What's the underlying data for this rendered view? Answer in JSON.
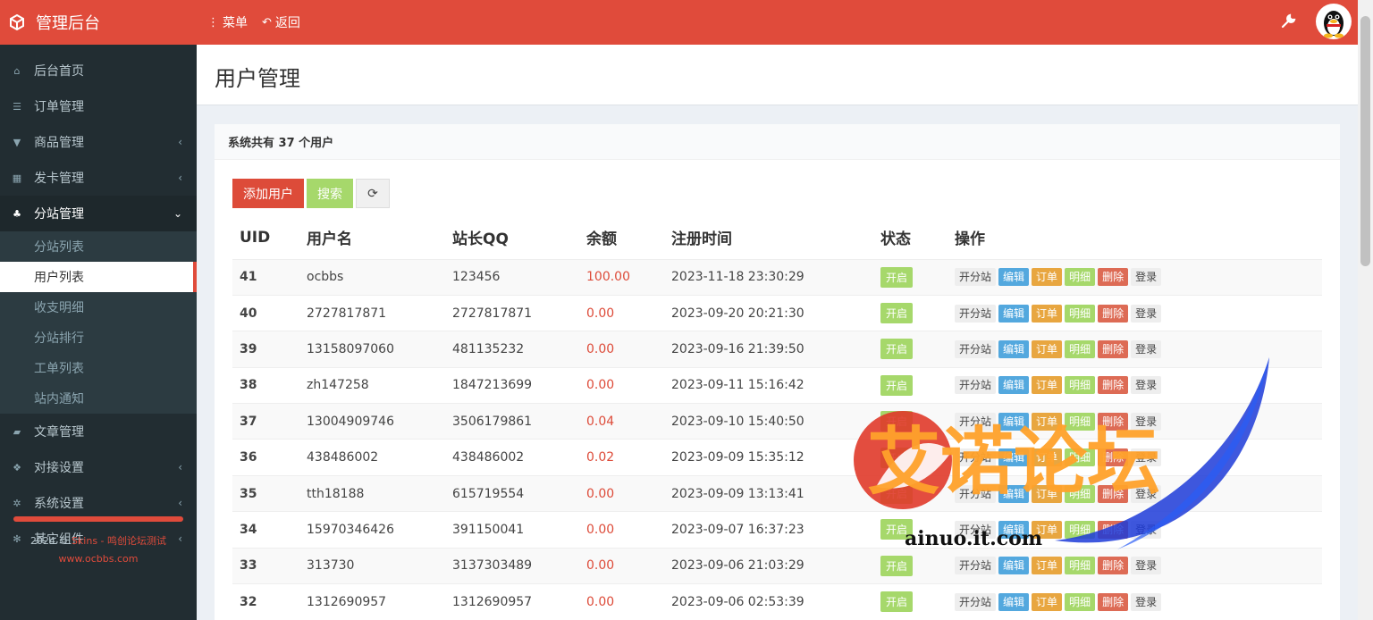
{
  "app": {
    "title": "管理后台",
    "menu_label": "菜单",
    "back_label": "返回"
  },
  "sidebar": {
    "items": [
      {
        "label": "后台首页",
        "icon": "home-icon"
      },
      {
        "label": "订单管理",
        "icon": "list-icon"
      },
      {
        "label": "商品管理",
        "icon": "cart-icon"
      },
      {
        "label": "发卡管理",
        "icon": "grid-icon"
      },
      {
        "label": "分站管理",
        "icon": "sitemap-icon"
      }
    ],
    "submenu": [
      "分站列表",
      "用户列表",
      "收支明细",
      "分站排行",
      "工单列表",
      "站内通知"
    ],
    "items_after": [
      {
        "label": "文章管理",
        "icon": "book-icon"
      },
      {
        "label": "对接设置",
        "icon": "cubes-icon"
      },
      {
        "label": "系统设置",
        "icon": "gear-icon"
      },
      {
        "label": "其它组件",
        "icon": "cogs-icon"
      }
    ],
    "footer_year": "2024 ©",
    "footer_brand": "Skins - 鸣创论坛测试",
    "footer_url": "www.ocbbs.com"
  },
  "page": {
    "title": "用户管理",
    "summary": "系统共有 37 个用户",
    "add_button": "添加用户",
    "search_button": "搜索"
  },
  "table": {
    "headers": [
      "UID",
      "用户名",
      "站长QQ",
      "余额",
      "注册时间",
      "状态",
      "操作"
    ],
    "ops": [
      "开分站",
      "编辑",
      "订单",
      "明细",
      "删除",
      "登录"
    ],
    "rows": [
      {
        "uid": "41",
        "username": "ocbbs",
        "qq": "123456",
        "balance": "100.00",
        "time": "2023-11-18 23:30:29",
        "status": "开启"
      },
      {
        "uid": "40",
        "username": "2727817871",
        "qq": "2727817871",
        "balance": "0.00",
        "time": "2023-09-20 20:21:30",
        "status": "开启"
      },
      {
        "uid": "39",
        "username": "13158097060",
        "qq": "481135232",
        "balance": "0.00",
        "time": "2023-09-16 21:39:50",
        "status": "开启"
      },
      {
        "uid": "38",
        "username": "zh147258",
        "qq": "1847213699",
        "balance": "0.00",
        "time": "2023-09-11 15:16:42",
        "status": "开启"
      },
      {
        "uid": "37",
        "username": "13004909746",
        "qq": "3506179861",
        "balance": "0.04",
        "time": "2023-09-10 15:40:50",
        "status": "开启"
      },
      {
        "uid": "36",
        "username": "438486002",
        "qq": "438486002",
        "balance": "0.02",
        "time": "2023-09-09 15:35:12",
        "status": "开启"
      },
      {
        "uid": "35",
        "username": "tth18188",
        "qq": "615719554",
        "balance": "0.00",
        "time": "2023-09-09 13:13:41",
        "status": "开启"
      },
      {
        "uid": "34",
        "username": "15970346426",
        "qq": "391150041",
        "balance": "0.00",
        "time": "2023-09-07 16:37:23",
        "status": "开启"
      },
      {
        "uid": "33",
        "username": "313730",
        "qq": "3137303489",
        "balance": "0.00",
        "time": "2023-09-06 21:03:29",
        "status": "开启"
      },
      {
        "uid": "32",
        "username": "1312690957",
        "qq": "1312690957",
        "balance": "0.00",
        "time": "2023-09-06 02:53:39",
        "status": "开启"
      }
    ]
  },
  "watermark": {
    "title": "艾诺论坛",
    "url": "ainuo.it.com"
  },
  "colors": {
    "brand_red": "#e04b3b",
    "sidebar_bg": "#222d32",
    "status_green": "#a6d86b"
  }
}
